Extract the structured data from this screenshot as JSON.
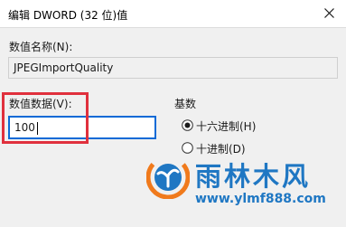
{
  "window": {
    "title": "编辑 DWORD (32 位)值"
  },
  "value_name": {
    "label": "数值名称(N):",
    "value": "JPEGImportQuality"
  },
  "value_data": {
    "label": "数值数据(V):",
    "value": "100"
  },
  "base": {
    "label": "基数",
    "options": [
      {
        "label": "十六进制(H)",
        "selected": true
      },
      {
        "label": "十进制(D)",
        "selected": false
      }
    ]
  },
  "watermark": {
    "title": "雨林木风",
    "url": "www.ylmf888.com"
  },
  "colors": {
    "highlight_box": "#e0303d",
    "focus_border": "#0a6ad6",
    "watermark_blue": "#1f77c3",
    "watermark_orange": "#f07a1c"
  },
  "icons": {
    "close": "close-icon",
    "watermark": "ylmf-logo-icon"
  }
}
